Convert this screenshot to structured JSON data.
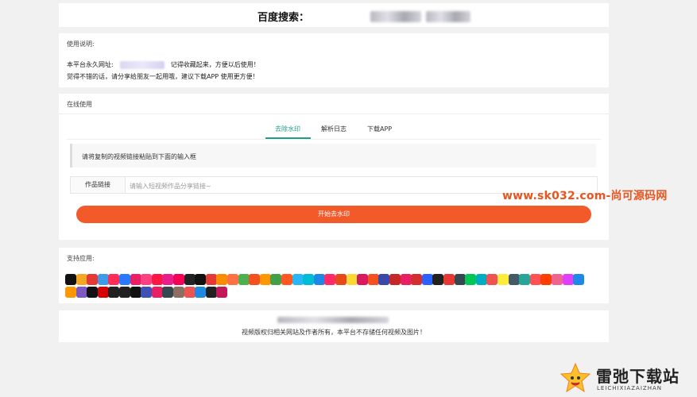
{
  "search": {
    "title": "百度搜索："
  },
  "usage": {
    "title": "使用说明:",
    "line1_prefix": "本平台永久网址:",
    "line1_suffix": "记得收藏起来，方便以后使用！",
    "line2": "觉得不错的话，请分享给朋友一起用哦，建议下载APP 使用更方便！"
  },
  "online": {
    "title": "在线使用",
    "tabs": [
      "去除水印",
      "解析日志",
      "下载APP"
    ],
    "active_tab": 0,
    "tip": "请将复制的视频链接粘贴到下面的输入框",
    "link_label": "作品链接",
    "link_placeholder": "请输入短视频作品分享链接~",
    "link_value": "",
    "start_button": "开始去水印"
  },
  "apps": {
    "title": "支持应用:",
    "row1_colors": [
      "#111111",
      "#f5a623",
      "#e53935",
      "#3d9be9",
      "#ff2d55",
      "#2979ff",
      "#e91e63",
      "#ff4081",
      "#ff1744",
      "#e91e8c",
      "#f50057",
      "#222222",
      "#111111",
      "#e53935",
      "#fb8c00",
      "#ff7043",
      "#4caf50",
      "#f4511e",
      "#ff9800",
      "#43a047",
      "#ff5722",
      "#29b6f6",
      "#00bcd4",
      "#1e88e5",
      "#ff2a68",
      "#e64a19",
      "#fdd835",
      "#d81b60",
      "#f4511e",
      "#3949ab",
      "#c62828",
      "#e91e63",
      "#d32f2f",
      "#2962ff",
      "#212121",
      "#e53935",
      "#37474f",
      "#00c853",
      "#00acc1",
      "#ef5350",
      "#ffeb3b",
      "#455a64",
      "#26a69a",
      "#ff5252",
      "#ff3d00",
      "#f06292",
      "#e040fb",
      "#1e88e5"
    ],
    "row2_colors": [
      "#ff9800",
      "#7e57c2",
      "#111111",
      "#d50000",
      "#212121",
      "#212121",
      "#111111",
      "#3f51b5",
      "#e91e63",
      "#37474f",
      "#8d6e63",
      "#ef5350",
      "#1e88e5",
      "#212121",
      "#c2185b"
    ]
  },
  "footer": {
    "copyright": "视频版权归相关网站及作者所有，本平台不存储任何视频及图片！"
  },
  "watermark": {
    "site": "www.sk032.com-尚可源码网"
  },
  "brand": {
    "name": "雷弛下载站",
    "sub": "LEICHIXIAZAIZHAN"
  }
}
